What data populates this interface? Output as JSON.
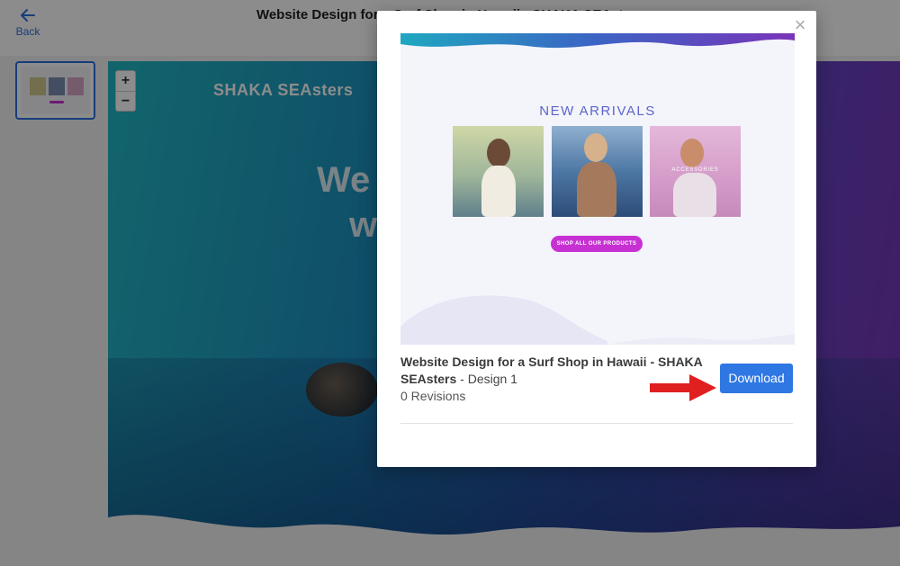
{
  "header": {
    "back_label": "Back",
    "title": "Website Design for a Surf Shop in Hawaii - SHAKA SEAsters"
  },
  "canvas": {
    "brand": "SHAKA SEAsters",
    "hero_line1": "We",
    "hero_line2": "w",
    "zoom_in": "+",
    "zoom_out": "−"
  },
  "modal": {
    "close_glyph": "×",
    "preview": {
      "heading": "NEW ARRIVALS",
      "products": [
        "",
        "",
        "ACCESSORIES"
      ],
      "cta": "SHOP ALL OUR PRODUCTS"
    },
    "design_title": "Website Design for a Surf Shop in Hawaii - SHAKA SEAsters",
    "design_suffix": " - Design 1",
    "revisions": "0 Revisions",
    "download_label": "Download"
  },
  "colors": {
    "accent": "#2f77e3",
    "cta": "#c730d3",
    "arrow": "#e02020"
  }
}
